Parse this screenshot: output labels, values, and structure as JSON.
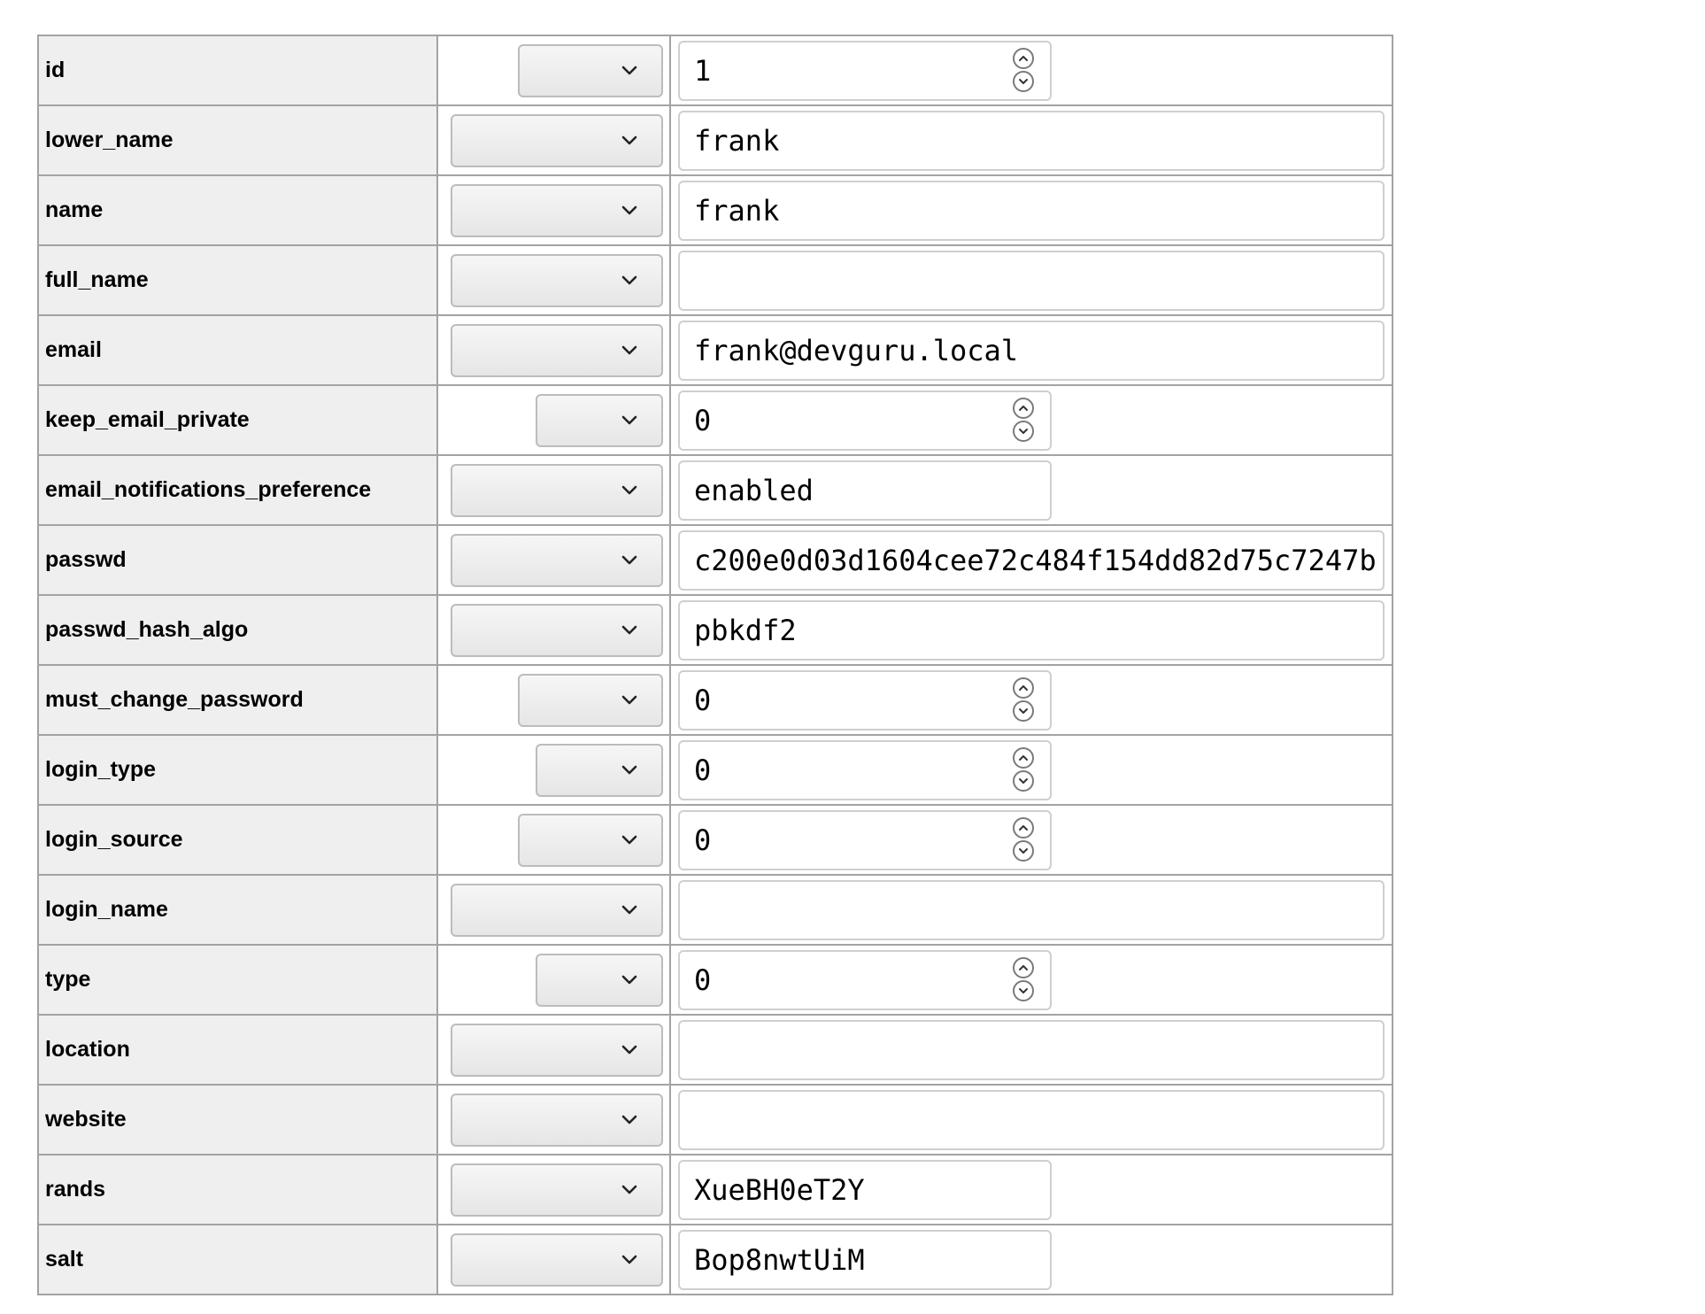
{
  "rows": [
    {
      "field": "id",
      "value": "1",
      "input": "number",
      "select": "mid"
    },
    {
      "field": "lower_name",
      "value": "frank",
      "input": "text-full",
      "select": "wide"
    },
    {
      "field": "name",
      "value": "frank",
      "input": "text-full",
      "select": "wide"
    },
    {
      "field": "full_name",
      "value": "",
      "input": "text-full",
      "select": "wide"
    },
    {
      "field": "email",
      "value": "frank@devguru.local",
      "input": "text-full",
      "select": "wide"
    },
    {
      "field": "keep_email_private",
      "value": "0",
      "input": "number",
      "select": "small"
    },
    {
      "field": "email_notifications_preference",
      "value": "enabled",
      "input": "text-short",
      "select": "wide"
    },
    {
      "field": "passwd",
      "value": "c200e0d03d1604cee72c484f154dd82d75c7247b",
      "input": "text-full",
      "select": "wide"
    },
    {
      "field": "passwd_hash_algo",
      "value": "pbkdf2",
      "input": "text-full",
      "select": "wide"
    },
    {
      "field": "must_change_password",
      "value": "0",
      "input": "number",
      "select": "mid"
    },
    {
      "field": "login_type",
      "value": "0",
      "input": "number",
      "select": "small"
    },
    {
      "field": "login_source",
      "value": "0",
      "input": "number",
      "select": "mid"
    },
    {
      "field": "login_name",
      "value": "",
      "input": "text-full",
      "select": "wide"
    },
    {
      "field": "type",
      "value": "0",
      "input": "number",
      "select": "small"
    },
    {
      "field": "location",
      "value": "",
      "input": "text-full",
      "select": "wide"
    },
    {
      "field": "website",
      "value": "",
      "input": "text-full",
      "select": "wide"
    },
    {
      "field": "rands",
      "value": "XueBH0eT2Y",
      "input": "text-short",
      "select": "wide"
    },
    {
      "field": "salt",
      "value": "Bop8nwtUiM",
      "input": "text-short",
      "select": "wide"
    }
  ],
  "icons": {
    "select": "chevron-down-icon",
    "spin_up": "chevron-up-icon",
    "spin_down": "chevron-down-icon"
  },
  "colors": {
    "name_cell_bg": "#efefef",
    "border": "#a3a3a3"
  }
}
